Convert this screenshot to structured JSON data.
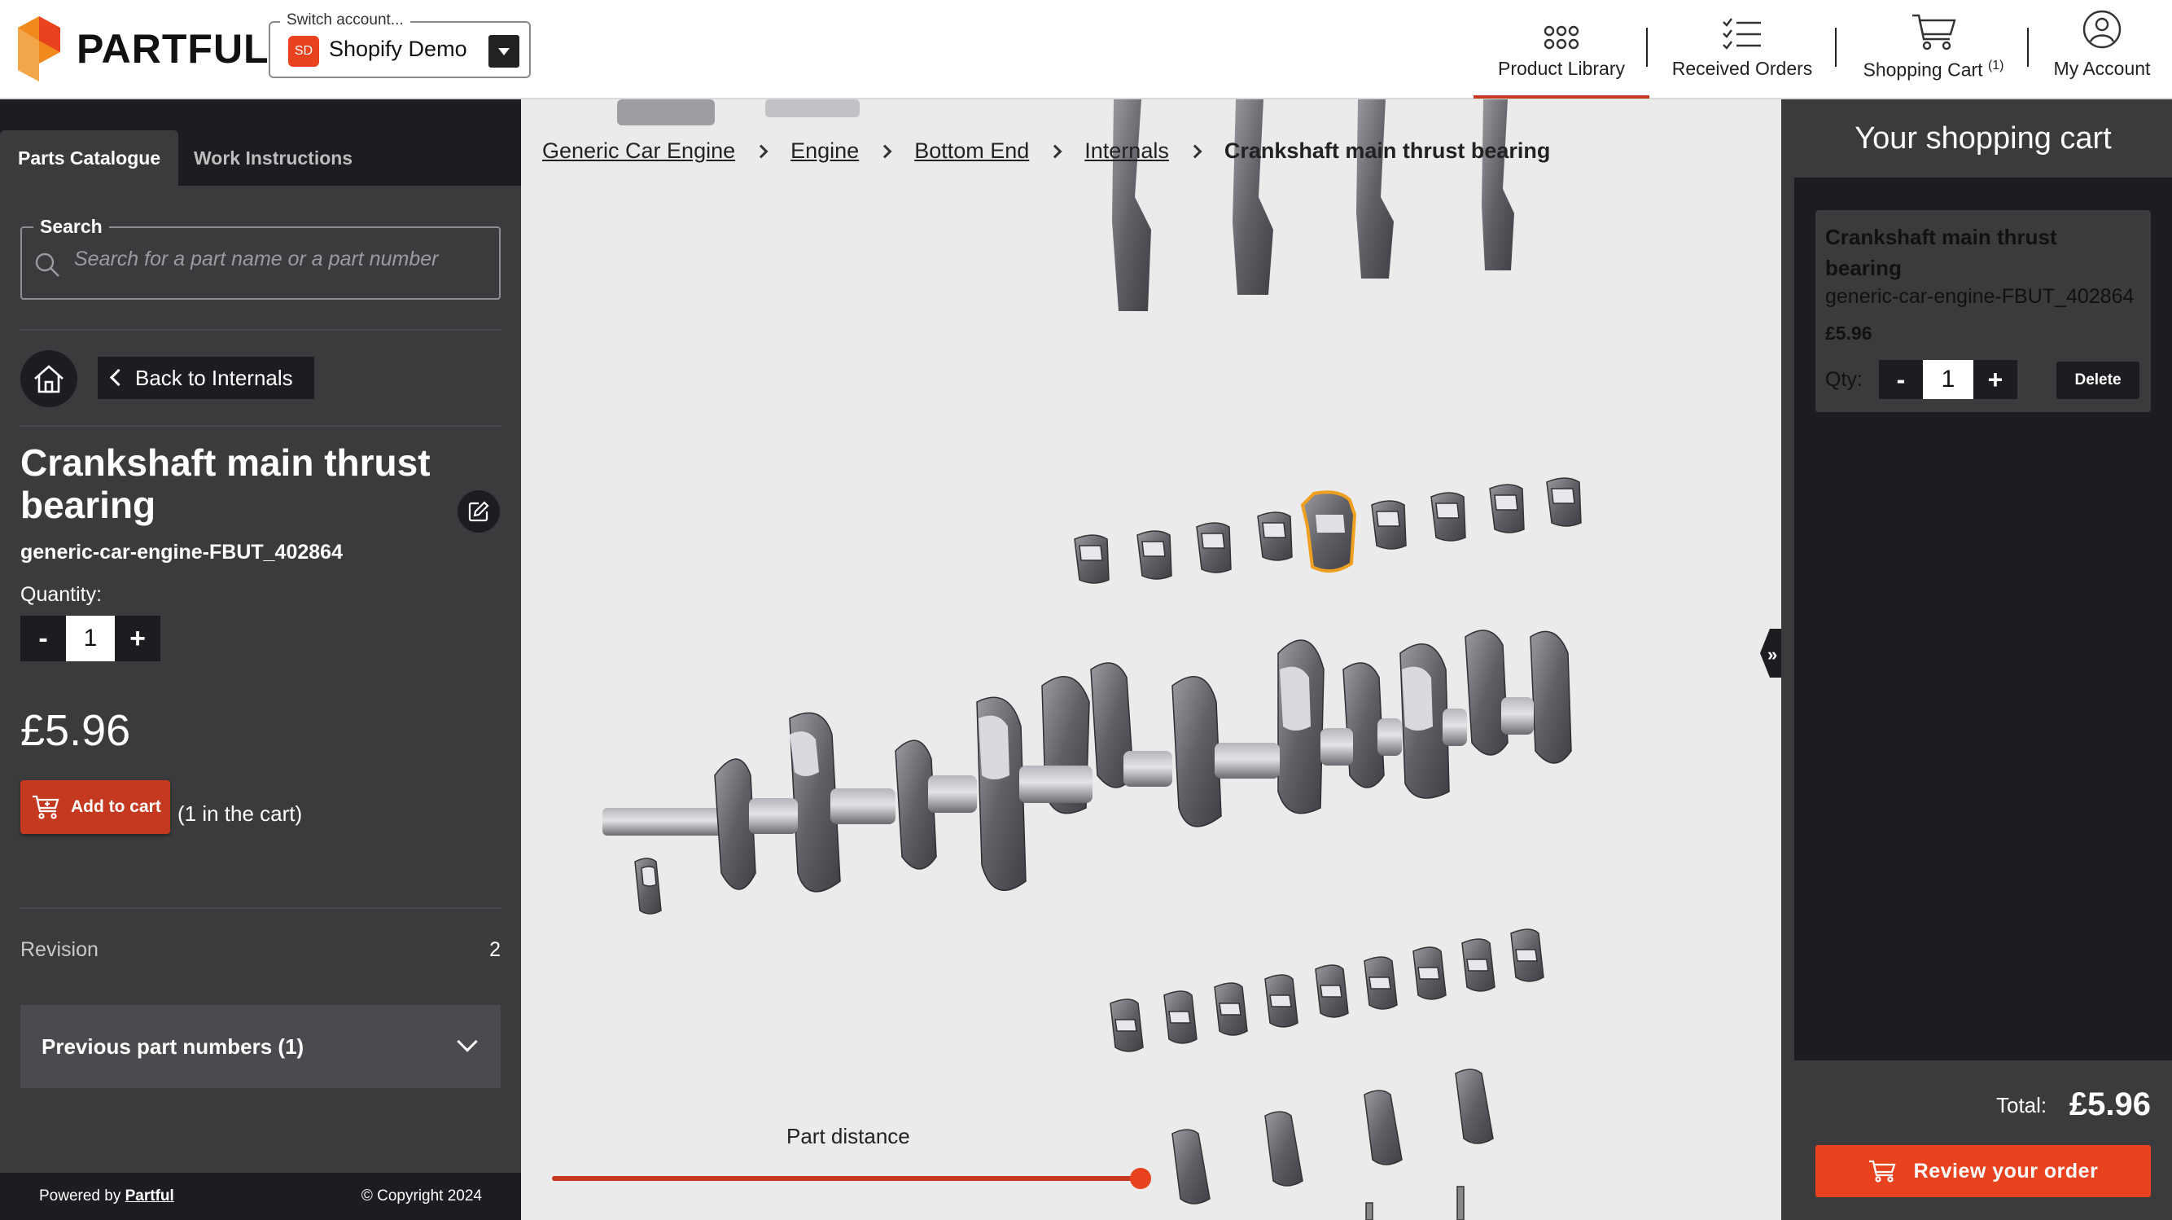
{
  "header": {
    "logo_text": "PARTFUL",
    "account": {
      "legend": "Switch account...",
      "badge": "SD",
      "name": "Shopify Demo"
    },
    "nav": [
      {
        "label": "Product Library",
        "icon": "grid-icon",
        "active": true
      },
      {
        "label": "Received Orders",
        "icon": "checklist-icon",
        "active": false
      },
      {
        "label": "Shopping Cart",
        "badge": "(1)",
        "icon": "cart-icon",
        "active": false
      },
      {
        "label": "My Account",
        "icon": "user-icon",
        "active": false
      }
    ]
  },
  "sidebar": {
    "tabs": [
      "Parts Catalogue",
      "Work Instructions"
    ],
    "search": {
      "legend": "Search",
      "placeholder": "Search for a part name or a part number"
    },
    "back_label": "Back to Internals",
    "part": {
      "title": "Crankshaft main thrust bearing",
      "number": "generic-car-engine-FBUT_402864",
      "quantity_label": "Quantity:",
      "quantity": "1",
      "minus": "-",
      "plus": "+",
      "price": "£5.96",
      "add_to_cart": "Add to cart",
      "in_cart": "(1 in the cart)"
    },
    "revision": {
      "label": "Revision",
      "value": "2"
    },
    "previous_parts": "Previous part numbers (1)",
    "footer": {
      "powered_by": "Powered by",
      "powered_link": "Partful",
      "copyright": "© Copyright 2024"
    }
  },
  "viewport": {
    "breadcrumb": [
      "Generic Car Engine",
      "Engine",
      "Bottom End",
      "Internals",
      "Crankshaft main thrust bearing"
    ],
    "slider_label": "Part distance",
    "slider_value": 1.0
  },
  "cart": {
    "title": "Your shopping cart",
    "item": {
      "name": "Crankshaft main thrust bearing",
      "number": "generic-car-engine-FBUT_402864",
      "price": "£5.96",
      "qty_label": "Qty:",
      "qty": "1",
      "minus": "-",
      "plus": "+",
      "delete": "Delete"
    },
    "total_label": "Total:",
    "total": "£5.96",
    "review": "Review your order"
  },
  "colors": {
    "accent": "#e8421f",
    "accent_dark": "#c4391f",
    "panel": "#3b3b3e",
    "panel_dark": "#1d1c21",
    "highlight": "#f0a020"
  }
}
